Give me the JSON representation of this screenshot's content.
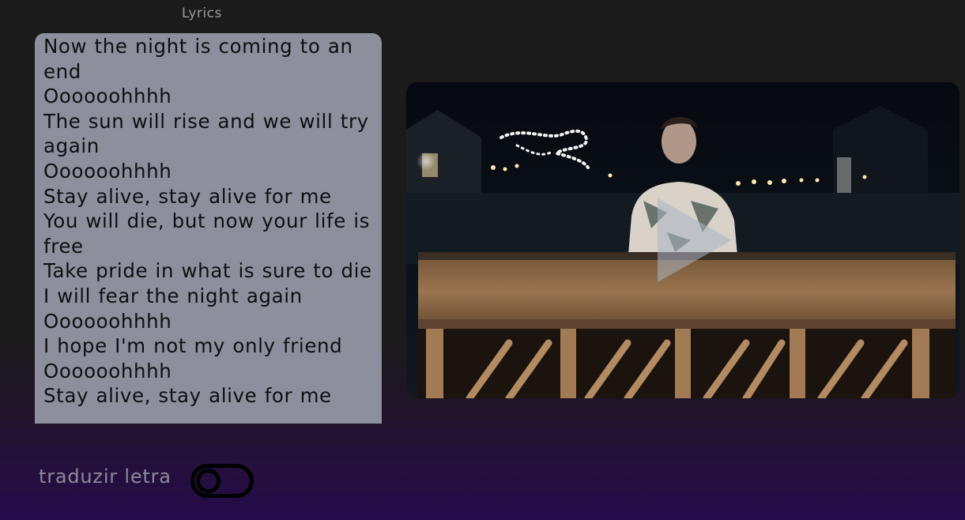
{
  "header": {
    "title": "Lyrics"
  },
  "lyrics": {
    "lines": [
      "Now the night is coming to an end",
      "Oooooohhhh",
      "The sun will rise and we will try again",
      "Oooooohhhh",
      "Stay alive, stay alive for me",
      "You will die, but now your life is free",
      "Take pride in what is sure to die",
      "I will fear the night again",
      "Oooooohhhh",
      "I hope I'm not my only friend",
      "Oooooohhhh",
      "Stay alive, stay alive for me"
    ]
  },
  "video": {
    "icon": "play-icon"
  },
  "translate": {
    "label": "traduzir letra",
    "enabled": false
  },
  "colors": {
    "lyrics_panel_bg": "#8d909c",
    "lyrics_text": "#0f0f12",
    "label_text": "#8d8a98",
    "toggle_border": "#000000"
  }
}
